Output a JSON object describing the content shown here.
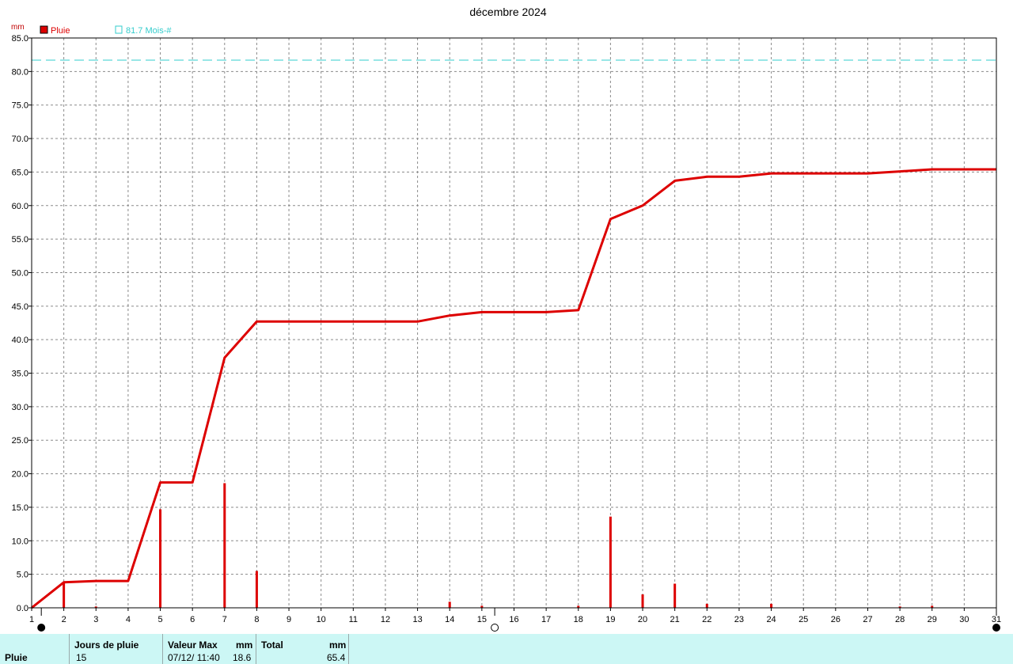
{
  "chart_data": {
    "type": "bar",
    "title": "décembre 2024",
    "unit_label": "mm",
    "ylim": [
      0,
      85
    ],
    "y_ticks": [
      "0.0",
      "5.0",
      "10.0",
      "15.0",
      "20.0",
      "25.0",
      "30.0",
      "35.0",
      "40.0",
      "45.0",
      "50.0",
      "55.0",
      "60.0",
      "65.0",
      "70.0",
      "75.0",
      "80.0",
      "85.0"
    ],
    "x_ticks": [
      "1",
      "2",
      "3",
      "4",
      "5",
      "6",
      "7",
      "8",
      "9",
      "10",
      "11",
      "12",
      "13",
      "14",
      "15",
      "16",
      "17",
      "18",
      "19",
      "20",
      "21",
      "22",
      "23",
      "24",
      "25",
      "26",
      "27",
      "28",
      "29",
      "30",
      "31"
    ],
    "xlim": [
      1,
      31
    ],
    "grid": true,
    "legend_position": "top-left",
    "legend": [
      {
        "label": "Pluie",
        "color": "#dd0000"
      },
      {
        "label": "81.7 Mois-#",
        "color": "#33cccc"
      }
    ],
    "series": [
      {
        "name": "Pluie",
        "kind": "daily_bars",
        "color": "#dd0000",
        "points": [
          {
            "day": 2,
            "value": 3.8
          },
          {
            "day": 3,
            "value": 0.2
          },
          {
            "day": 5,
            "value": 14.7
          },
          {
            "day": 7,
            "value": 18.6
          },
          {
            "day": 8,
            "value": 5.5
          },
          {
            "day": 14,
            "value": 0.9
          },
          {
            "day": 15,
            "value": 0.3
          },
          {
            "day": 18,
            "value": 0.3
          },
          {
            "day": 19,
            "value": 13.6
          },
          {
            "day": 20,
            "value": 2.0
          },
          {
            "day": 21,
            "value": 3.6
          },
          {
            "day": 22,
            "value": 0.6
          },
          {
            "day": 24,
            "value": 0.6
          },
          {
            "day": 28,
            "value": 0.2
          },
          {
            "day": 29,
            "value": 0.3
          }
        ]
      },
      {
        "name": "Pluie",
        "kind": "cumulative_line",
        "color": "#dd0000",
        "points": [
          {
            "day": 1,
            "value": 0.0
          },
          {
            "day": 2,
            "value": 3.8
          },
          {
            "day": 3,
            "value": 4.0
          },
          {
            "day": 4,
            "value": 4.0
          },
          {
            "day": 5,
            "value": 18.7
          },
          {
            "day": 6,
            "value": 18.7
          },
          {
            "day": 7,
            "value": 37.3
          },
          {
            "day": 8,
            "value": 42.7
          },
          {
            "day": 13,
            "value": 42.7
          },
          {
            "day": 14,
            "value": 43.6
          },
          {
            "day": 15,
            "value": 44.1
          },
          {
            "day": 17,
            "value": 44.1
          },
          {
            "day": 18,
            "value": 44.4
          },
          {
            "day": 19,
            "value": 58.0
          },
          {
            "day": 20,
            "value": 60.0
          },
          {
            "day": 21,
            "value": 63.7
          },
          {
            "day": 22,
            "value": 64.3
          },
          {
            "day": 23,
            "value": 64.3
          },
          {
            "day": 24,
            "value": 64.8
          },
          {
            "day": 27,
            "value": 64.8
          },
          {
            "day": 28,
            "value": 65.1
          },
          {
            "day": 29,
            "value": 65.4
          },
          {
            "day": 31,
            "value": 65.4
          }
        ]
      },
      {
        "name": "81.7 Mois-#",
        "kind": "reference_line",
        "color": "#33cccc",
        "value": 81.7
      }
    ],
    "moon_phases": [
      {
        "day": 1.3,
        "phase": "new-moon"
      },
      {
        "day": 15.4,
        "phase": "full-moon"
      },
      {
        "day": 31,
        "phase": "new-moon"
      }
    ]
  },
  "stats": {
    "row_label": "Pluie",
    "rain_days_header": "Jours de pluie",
    "rain_days_value": "15",
    "max_header": "Valeur Max",
    "max_unit": "mm",
    "max_date": "07/12/  11:40",
    "max_value": "18.6",
    "total_header": "Total",
    "total_unit": "mm",
    "total_value": "65.4"
  }
}
